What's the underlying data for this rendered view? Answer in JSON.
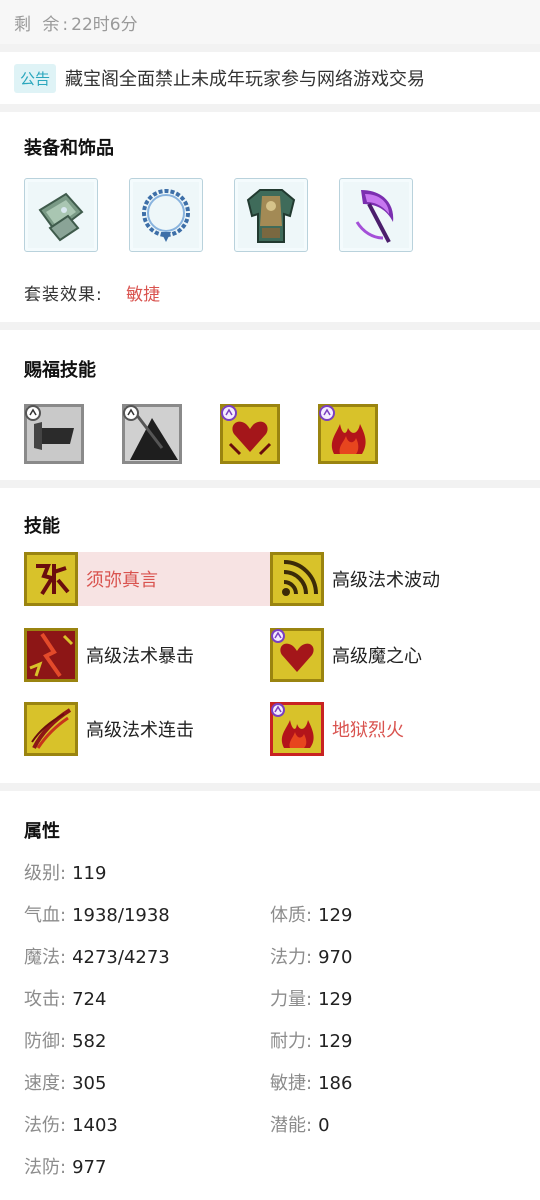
{
  "remaining": {
    "label": "剩 余:",
    "value": "22时6分"
  },
  "notice": {
    "tag": "公告",
    "text": "藏宝阁全面禁止未成年玩家参与网络游戏交易"
  },
  "equipment": {
    "title": "装备和饰品",
    "items": [
      {
        "icon": "bracer-icon"
      },
      {
        "icon": "necklace-icon"
      },
      {
        "icon": "armor-icon"
      },
      {
        "icon": "scythe-weapon-icon"
      }
    ],
    "set_label": "套装效果:",
    "set_value": "敏捷"
  },
  "blessing": {
    "title": "赐福技能",
    "items": [
      {
        "icon": "armor-blessing-icon"
      },
      {
        "icon": "shadow-blessing-icon"
      },
      {
        "icon": "demon-heart-blessing-icon"
      },
      {
        "icon": "flame-blessing-icon"
      }
    ]
  },
  "skills": {
    "title": "技能",
    "items": [
      {
        "name": "须弥真言",
        "icon": "rune-skill-icon"
      },
      {
        "name": "高级法术波动",
        "icon": "wave-skill-icon"
      },
      {
        "name": "高级法术暴击",
        "icon": "crit-skill-icon"
      },
      {
        "name": "高级魔之心",
        "icon": "demon-heart-skill-icon"
      },
      {
        "name": "高级法术连击",
        "icon": "combo-skill-icon"
      },
      {
        "name": "地狱烈火",
        "icon": "hellfire-skill-icon"
      }
    ]
  },
  "attributes": {
    "title": "属性",
    "items": [
      {
        "label": "级别:",
        "value": "119"
      },
      {
        "label": "气血:",
        "value": "1938/1938"
      },
      {
        "label": "体质:",
        "value": "129"
      },
      {
        "label": "魔法:",
        "value": "4273/4273"
      },
      {
        "label": "法力:",
        "value": "970"
      },
      {
        "label": "攻击:",
        "value": "724"
      },
      {
        "label": "力量:",
        "value": "129"
      },
      {
        "label": "防御:",
        "value": "582"
      },
      {
        "label": "耐力:",
        "value": "129"
      },
      {
        "label": "速度:",
        "value": "305"
      },
      {
        "label": "敏捷:",
        "value": "186"
      },
      {
        "label": "法伤:",
        "value": "1403"
      },
      {
        "label": "潜能:",
        "value": "0"
      },
      {
        "label": "法防:",
        "value": "977"
      }
    ]
  },
  "colors": {
    "accent_red": "#d9534f",
    "tag_teal": "#2ba7bd",
    "icon_gold": "#c9b21e"
  }
}
